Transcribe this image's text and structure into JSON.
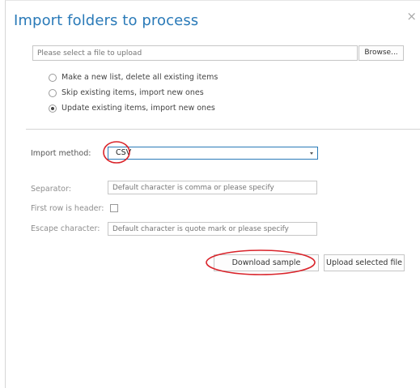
{
  "dialog": {
    "title": "Import folders to process",
    "close_icon": "close-icon",
    "close_glyph": "×"
  },
  "file_upload": {
    "placeholder": "Please select a file to upload",
    "browse_label": "Browse..."
  },
  "import_mode": {
    "options": [
      {
        "label": "Make a new list, delete all existing items",
        "checked": false
      },
      {
        "label": "Skip existing items, import new ones",
        "checked": false
      },
      {
        "label": "Update existing items, import new ones",
        "checked": true
      }
    ]
  },
  "form": {
    "import_method_label": "Import method:",
    "import_method_value": "CSV",
    "separator_label": "Separator:",
    "separator_placeholder": "Default character is comma or please specify",
    "first_row_header_label": "First row is header:",
    "first_row_header_checked": false,
    "escape_label": "Escape character:",
    "escape_placeholder": "Default character is quote mark or please specify"
  },
  "actions": {
    "download_sample_label": "Download sample",
    "upload_selected_label": "Upload selected file"
  },
  "colors": {
    "title": "#2a7ab8",
    "select_border": "#2a7ab8",
    "annotation": "#d9232a"
  }
}
